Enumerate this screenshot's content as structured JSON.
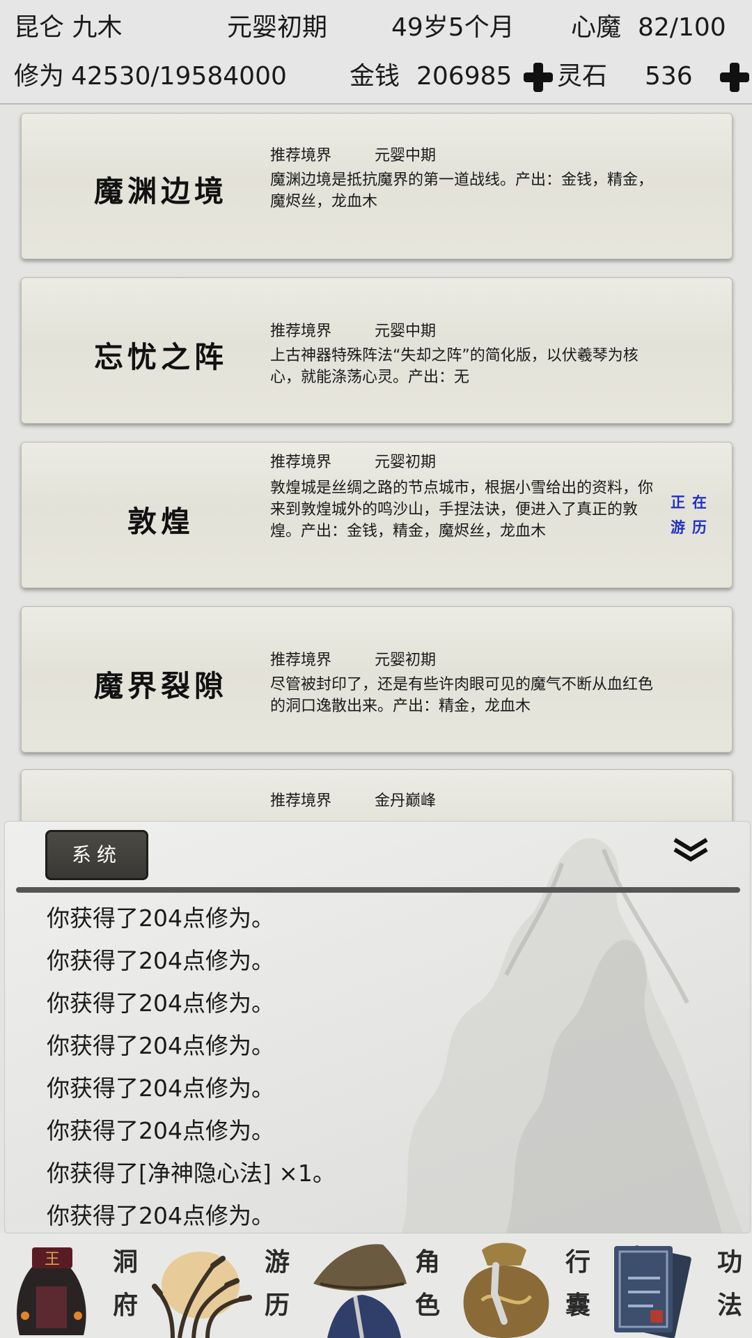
{
  "header": {
    "player_name": "昆仑 九木",
    "realm": "元婴初期",
    "age": "49岁5个月",
    "heart_demon_label": "心魔",
    "heart_demon_value": "82/100",
    "cultivation_label": "修为",
    "cultivation_value": "42530/19584000",
    "money_label": "金钱",
    "money_value": "206985",
    "spirit_stone_label": "灵石",
    "spirit_stone_value": "536"
  },
  "locations": [
    {
      "name": "魔渊边境",
      "realm_label": "推荐境界",
      "realm": "元婴中期",
      "desc": "魔渊边境是抵抗魔界的第一道战线。产出：金钱，精金，魔烬丝，龙血木"
    },
    {
      "name": "忘忧之阵",
      "realm_label": "推荐境界",
      "realm": "元婴中期",
      "desc": "上古神器特殊阵法“失却之阵”的简化版，以伏羲琴为核心，就能涤荡心灵。产出：无"
    },
    {
      "name": "敦煌",
      "realm_label": "推荐境界",
      "realm": "元婴初期",
      "desc": "敦煌城是丝绸之路的节点城市，根据小雪给出的资料，你来到敦煌城外的鸣沙山，手捏法诀，便进入了真正的敦煌。产出：金钱，精金，魔烬丝，龙血木",
      "status": "正在游历"
    },
    {
      "name": "魔界裂隙",
      "realm_label": "推荐境界",
      "realm": "元婴初期",
      "desc": "尽管被封印了，还是有些许肉眼可见的魔气不断从血红色的洞口逸散出来。产出：精金，龙血木"
    },
    {
      "name": "",
      "realm_label": "推荐境界",
      "realm": "金丹巅峰",
      "desc": ""
    }
  ],
  "log": {
    "tab_label": "系统",
    "lines": [
      "你获得了204点修为。",
      "你获得了204点修为。",
      "你获得了204点修为。",
      "你获得了204点修为。",
      "你获得了204点修为。",
      "你获得了204点修为。",
      "你获得了[净神隐心法] ×1。",
      "你获得了204点修为。"
    ]
  },
  "nav": {
    "items": [
      {
        "label_1": "洞",
        "label_2": "府",
        "icon": "cave-dwelling-icon"
      },
      {
        "label_1": "游",
        "label_2": "历",
        "icon": "travel-grass-icon"
      },
      {
        "label_1": "角",
        "label_2": "色",
        "icon": "character-hat-icon"
      },
      {
        "label_1": "行",
        "label_2": "囊",
        "icon": "bag-icon"
      },
      {
        "label_1": "功",
        "label_2": "法",
        "icon": "books-icon"
      }
    ]
  }
}
